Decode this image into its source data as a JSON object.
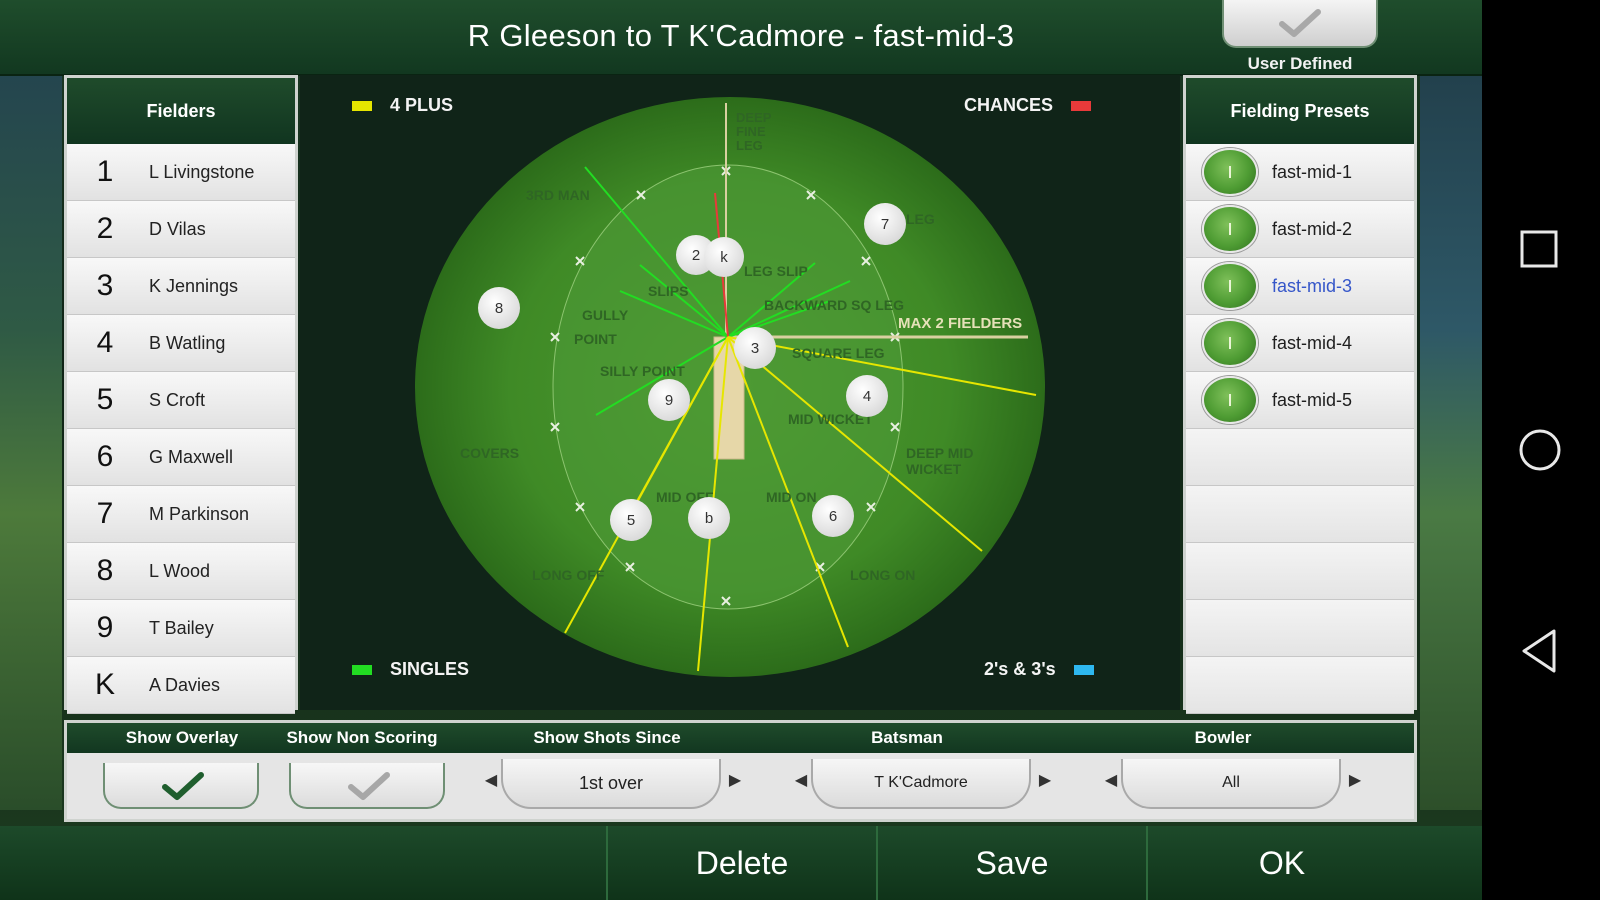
{
  "title": "R Gleeson to T K'Cadmore - fast-mid-3",
  "user_defined_label": "User Defined",
  "fielders_panel": {
    "header": "Fielders",
    "items": [
      {
        "num": "1",
        "name": "L Livingstone"
      },
      {
        "num": "2",
        "name": "D Vilas"
      },
      {
        "num": "3",
        "name": "K Jennings"
      },
      {
        "num": "4",
        "name": "B Watling"
      },
      {
        "num": "5",
        "name": "S Croft"
      },
      {
        "num": "6",
        "name": "G Maxwell"
      },
      {
        "num": "7",
        "name": "M Parkinson"
      },
      {
        "num": "8",
        "name": "L Wood"
      },
      {
        "num": "9",
        "name": "T Bailey"
      },
      {
        "num": "K",
        "name": "A Davies"
      }
    ]
  },
  "presets_panel": {
    "header": "Fielding Presets",
    "items": [
      "fast-mid-1",
      "fast-mid-2",
      "fast-mid-3",
      "fast-mid-4",
      "fast-mid-5"
    ],
    "selected": "fast-mid-3"
  },
  "legend": {
    "four_plus": "4 PLUS",
    "chances": "CHANCES",
    "singles": "SINGLES",
    "twos_threes": "2's & 3's",
    "colors": {
      "four_plus": "#e6e600",
      "chances": "#e83a3a",
      "singles": "#22dd22",
      "twos_threes": "#2eb8f0"
    }
  },
  "field": {
    "positions": [
      "DEEP FINE LEG",
      "3RD MAN",
      "LEG SLIP",
      "SLIPS",
      "GULLY",
      "POINT",
      "BACKWARD SQ LEG",
      "SILLY POINT",
      "SQUARE LEG",
      "MID WICKET",
      "COVERS",
      "DEEP MID WICKET",
      "MID OFF",
      "MID ON",
      "LONG OFF",
      "LONG ON",
      "LEG"
    ],
    "restriction": "MAX 2 FIELDERS",
    "fielder_markers": [
      "2",
      "k",
      "7",
      "8",
      "3",
      "9",
      "4",
      "5",
      "b",
      "6"
    ]
  },
  "controls": {
    "show_overlay": "Show Overlay",
    "show_non_scoring": "Show Non Scoring",
    "show_shots_since": "Show Shots Since",
    "batsman": "Batsman",
    "bowler": "Bowler",
    "shots_since_value": "1st over",
    "batsman_value": "T K'Cadmore",
    "bowler_value": "All",
    "overlay_checked": true,
    "non_scoring_checked": false
  },
  "footer": {
    "delete": "Delete",
    "save": "Save",
    "ok": "OK"
  }
}
